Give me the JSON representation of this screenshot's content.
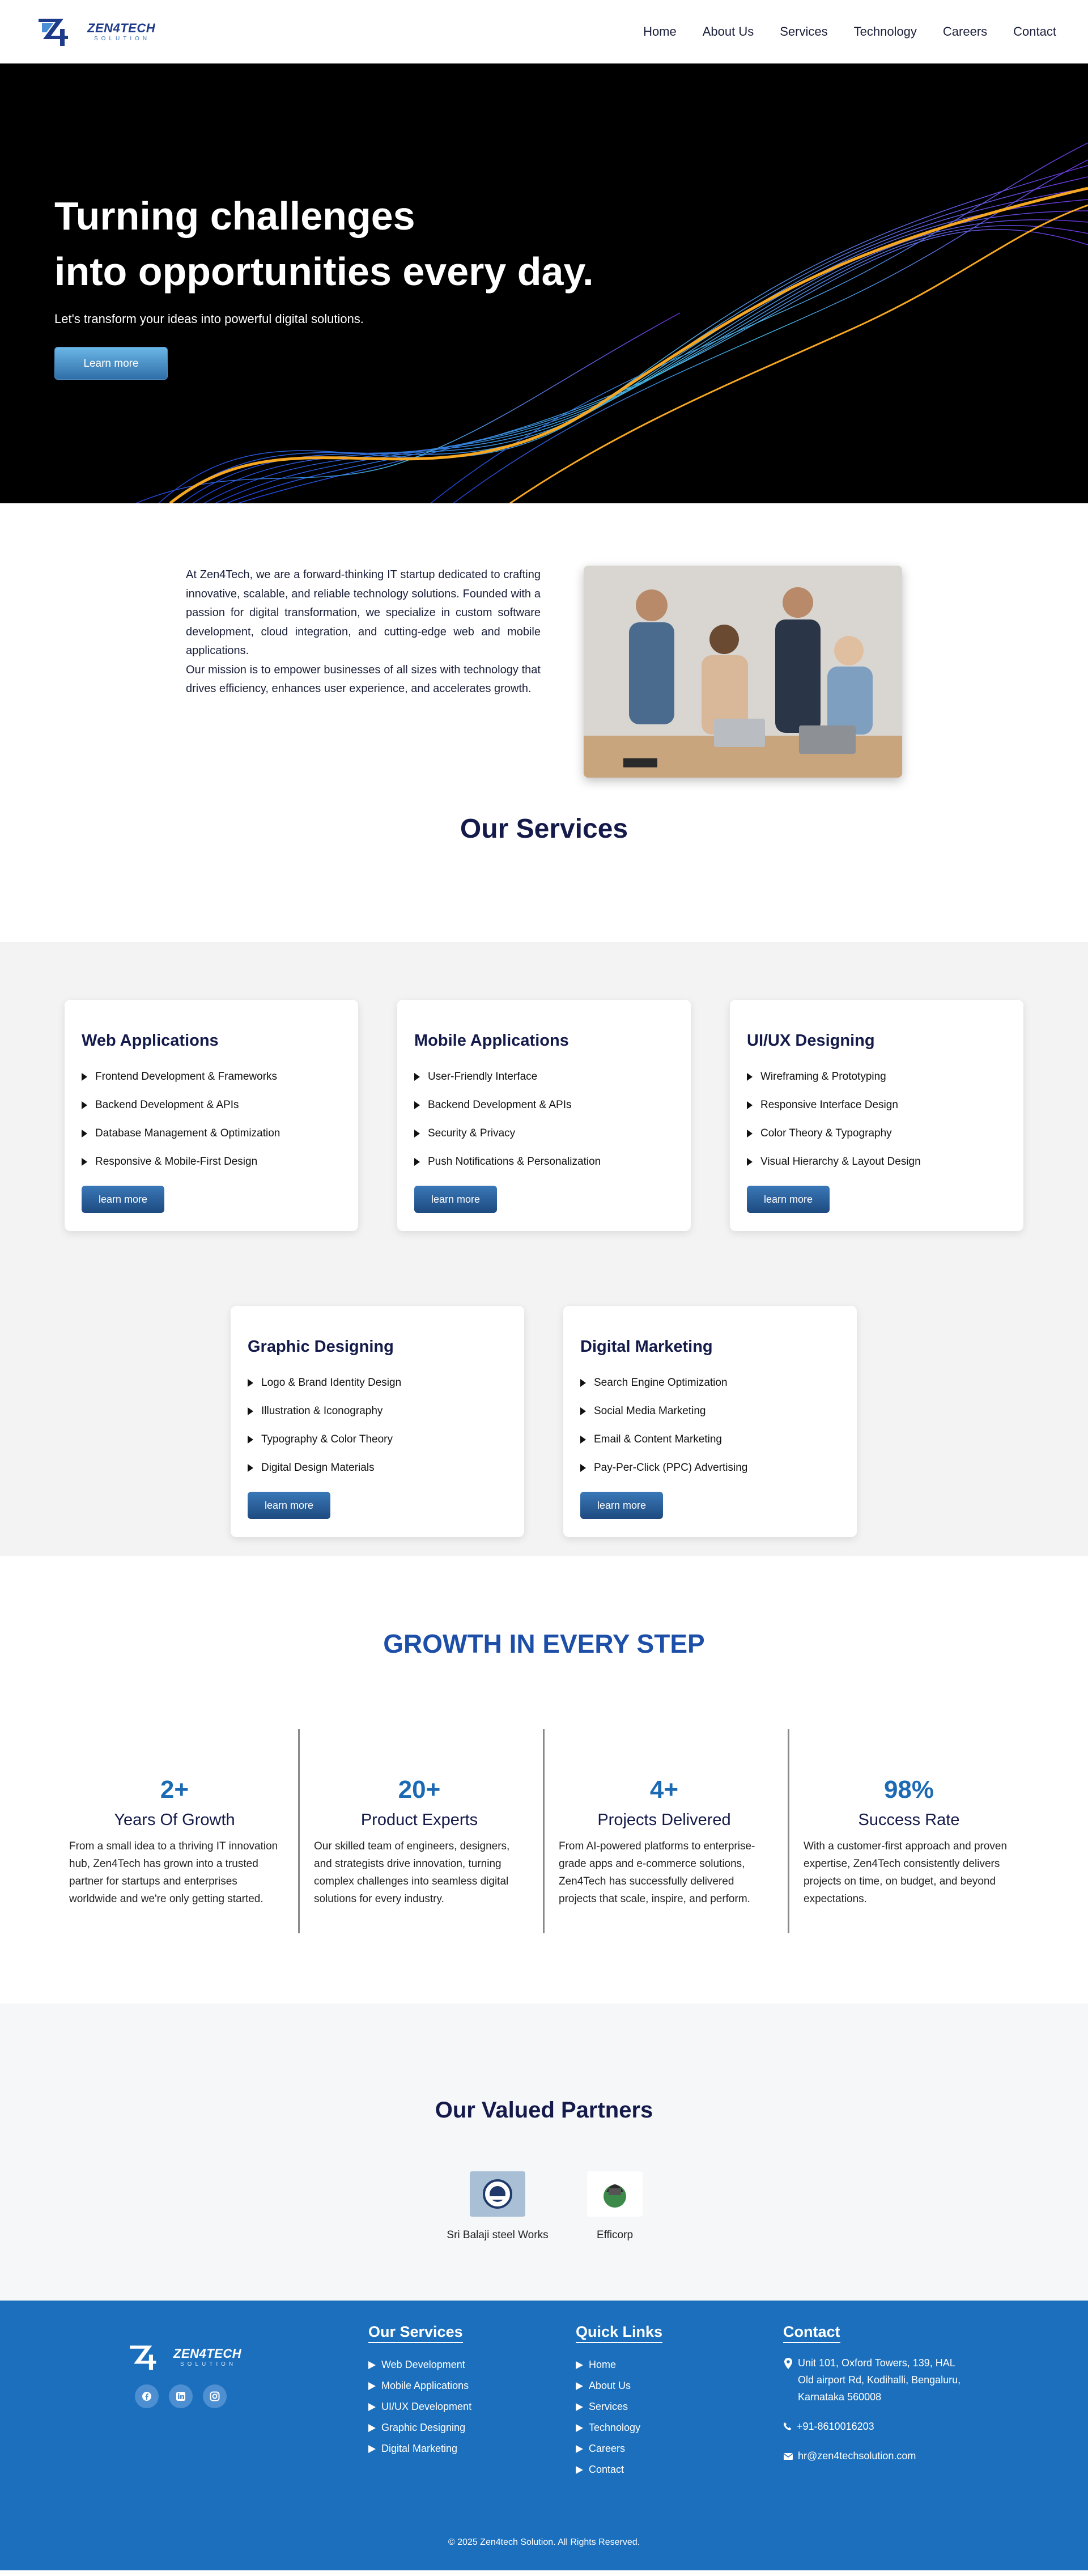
{
  "nav": {
    "logo_text": "ZEN4TECH",
    "logo_sub": "SOLUTION",
    "links": [
      "Home",
      "About Us",
      "Services",
      "Technology",
      "Careers",
      "Contact"
    ]
  },
  "hero": {
    "title_line1": "Turning challenges",
    "title_line2": "into opportunities every day.",
    "subtitle": "Let's transform your ideas into powerful digital solutions.",
    "button": "Learn more"
  },
  "about": {
    "p1": "At Zen4Tech, we are a forward-thinking IT startup dedicated to crafting innovative, scalable, and reliable technology solutions. Founded with a passion for digital transformation, we specialize in custom software development, cloud integration, and cutting-edge web and mobile applications.",
    "p2": "Our mission is to empower businesses of all sizes with technology that drives efficiency, enhances user experience, and accelerates growth."
  },
  "services": {
    "title": "Our Services",
    "cards": [
      {
        "title": "Web Applications",
        "items": [
          "Frontend Development & Frameworks",
          "Backend Development & APIs",
          "Database Management & Optimization",
          "Responsive & Mobile-First Design"
        ],
        "button": "learn more"
      },
      {
        "title": "Mobile Applications",
        "items": [
          "User-Friendly Interface",
          "Backend Development & APIs",
          "Security & Privacy",
          "Push Notifications & Personalization"
        ],
        "button": "learn more"
      },
      {
        "title": "UI/UX Designing",
        "items": [
          "Wireframing & Prototyping",
          "Responsive Interface Design",
          "Color Theory & Typography",
          "Visual Hierarchy & Layout Design"
        ],
        "button": "learn more"
      },
      {
        "title": "Graphic Designing",
        "items": [
          "Logo & Brand Identity Design",
          "Illustration & Iconography",
          "Typography & Color Theory",
          "Digital Design Materials"
        ],
        "button": "learn more"
      },
      {
        "title": "Digital Marketing",
        "items": [
          "Search Engine Optimization",
          "Social Media Marketing",
          "Email & Content Marketing",
          "Pay-Per-Click (PPC) Advertising"
        ],
        "button": "learn more"
      }
    ]
  },
  "growth": {
    "title": "GROWTH IN EVERY STEP",
    "stats": [
      {
        "num": "2+",
        "label": "Years Of Growth",
        "desc": "From a small idea to a thriving IT innovation hub, Zen4Tech has grown into a trusted partner for startups and enterprises worldwide and we're only getting started."
      },
      {
        "num": "20+",
        "label": "Product Experts",
        "desc": "Our skilled team of engineers, designers, and strategists drive innovation, turning complex challenges into seamless digital solutions for every industry."
      },
      {
        "num": "4+",
        "label": "Projects Delivered",
        "desc": "From AI-powered platforms to enterprise-grade apps and e-commerce solutions, Zen4Tech has successfully delivered projects that scale, inspire, and perform."
      },
      {
        "num": "98%",
        "label": "Success Rate",
        "desc": "With a customer-first approach and proven expertise, Zen4Tech consistently delivers projects on time, on budget, and beyond expectations."
      }
    ]
  },
  "partners": {
    "title": "Our Valued Partners",
    "items": [
      "Sri Balaji steel Works",
      "Efficorp"
    ]
  },
  "footer": {
    "services_title": "Our Services",
    "services": [
      "Web Development",
      "Mobile Applications",
      "UI/UX Development",
      "Graphic Designing",
      "Digital Marketing"
    ],
    "links_title": "Quick Links",
    "links": [
      "Home",
      "About Us",
      "Services",
      "Technology",
      "Careers",
      "Contact"
    ],
    "contact_title": "Contact",
    "address": "Unit 101, Oxford Towers, 139, HAL Old airport Rd, Kodihalli, Bengaluru, Karnataka 560008",
    "phone": "+91-8610016203",
    "email": "hr@zen4techsolution.com",
    "copyright": "© 2025 Zen4tech Solution. All Rights Reserved."
  },
  "colors": {
    "brand_blue": "#1b6fbd",
    "navy": "#141a4a",
    "accent": "#1d4fa8"
  }
}
